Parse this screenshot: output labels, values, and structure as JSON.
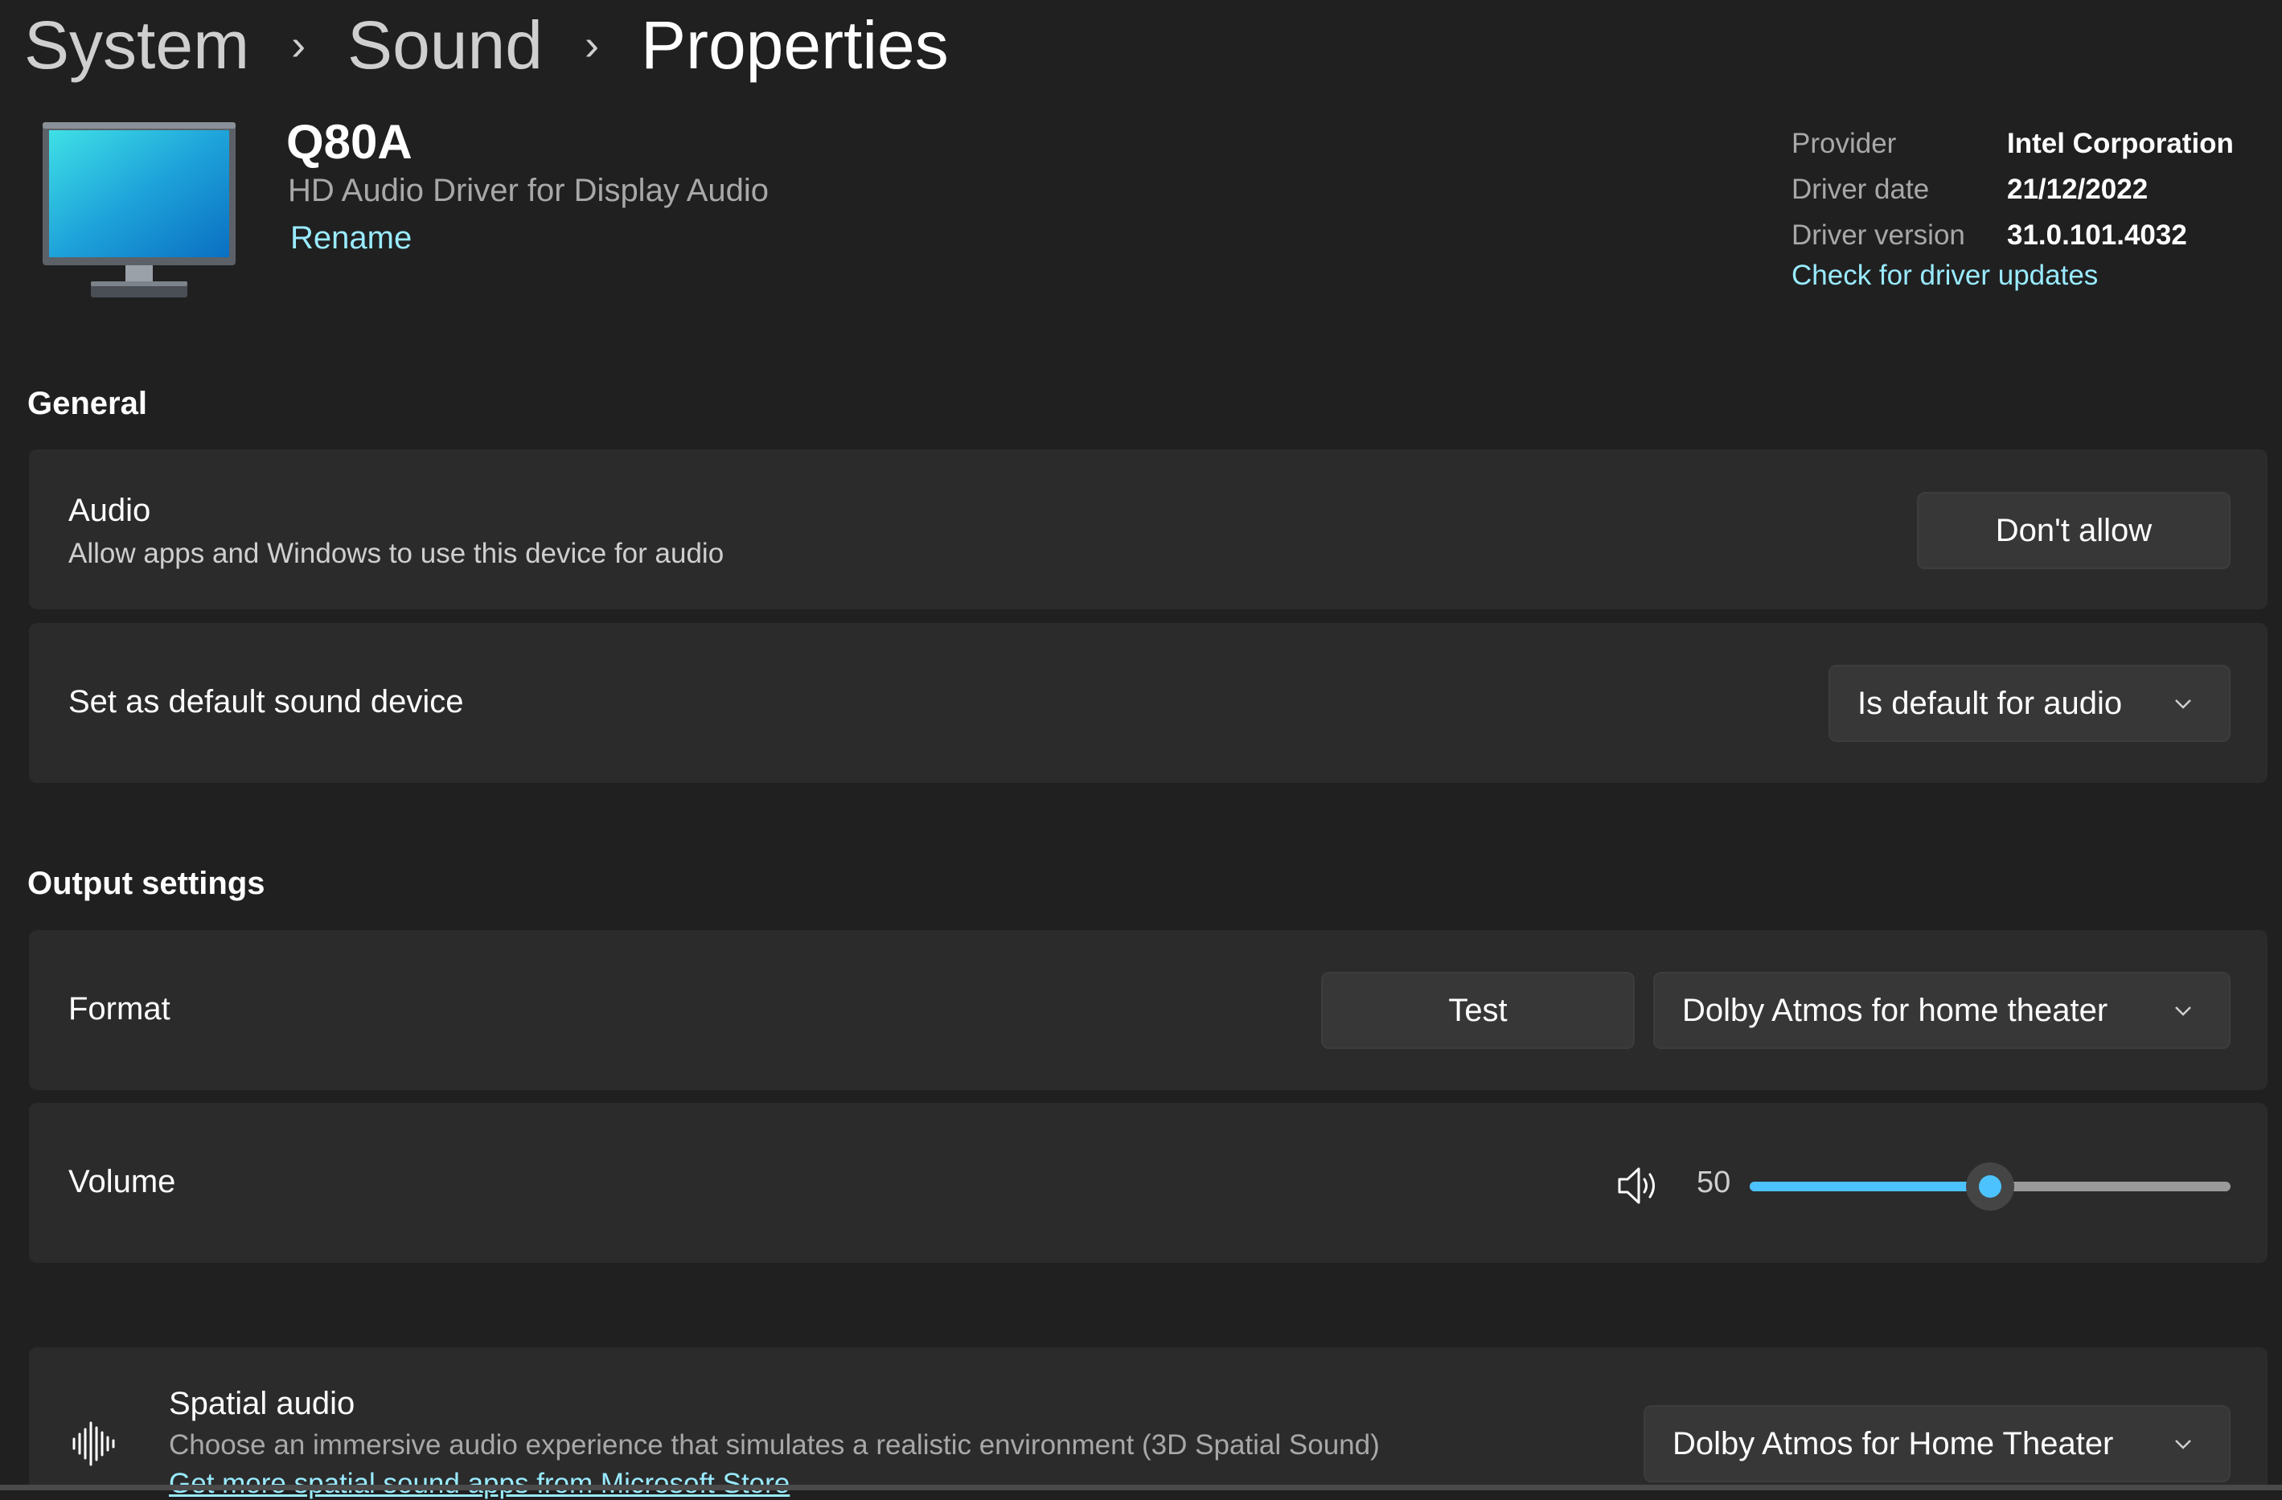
{
  "breadcrumb": {
    "items": [
      "System",
      "Sound"
    ],
    "current": "Properties",
    "separator": "›"
  },
  "device": {
    "icon": "monitor-icon",
    "name": "Q80A",
    "driver_description": "HD Audio Driver for Display Audio",
    "rename_label": "Rename"
  },
  "driver_info": {
    "rows": [
      {
        "label": "Provider",
        "value": "Intel Corporation"
      },
      {
        "label": "Driver date",
        "value": "21/12/2022"
      },
      {
        "label": "Driver version",
        "value": "31.0.101.4032"
      }
    ],
    "check_updates_label": "Check for driver updates"
  },
  "general": {
    "title": "General",
    "audio": {
      "title": "Audio",
      "description": "Allow apps and Windows to use this device for audio",
      "button_label": "Don't allow"
    },
    "default_device": {
      "title": "Set as default sound device",
      "selected": "Is default for audio"
    }
  },
  "output_settings": {
    "title": "Output settings",
    "format": {
      "title": "Format",
      "test_label": "Test",
      "selected": "Dolby Atmos for home theater"
    },
    "volume": {
      "title": "Volume",
      "icon": "speaker-volume-icon",
      "value": "50",
      "percent": 50
    }
  },
  "spatial_audio": {
    "icon": "sound-wave-icon",
    "title": "Spatial audio",
    "description": "Choose an immersive audio experience that simulates a realistic environment (3D Spatial Sound)",
    "store_link": "Get more spatial sound apps from Microsoft Store",
    "selected": "Dolby Atmos for Home Theater"
  },
  "colors": {
    "background": "#202020",
    "card": "#2b2b2b",
    "accent": "#4cc2ff",
    "link": "#99ebff"
  }
}
